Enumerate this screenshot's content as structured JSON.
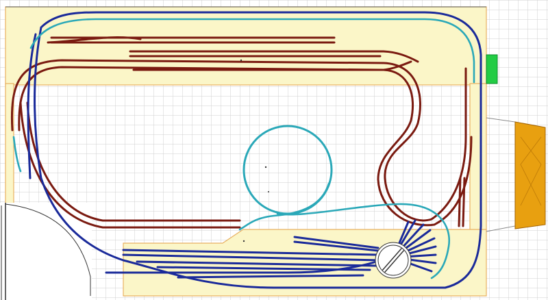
{
  "canvas": {
    "background": "#ffffff",
    "grid_color": "#cfcfcf"
  },
  "colors": {
    "baseboard_fill": "#fbf6c8",
    "baseboard_edge": "#e8b060",
    "upper_level_track": "#7a1a10",
    "upper_level_rail_gap": "#b86a5a",
    "main_loop_track": "#1a2a9a",
    "helix_track": "#2aa8b8",
    "turntable_outline": "#333333",
    "building": "#e8a010",
    "building_outline": "#a06000",
    "power_box": "#22cc44",
    "wall_line": "#333333"
  },
  "icons": {
    "turntable": "turntable-icon",
    "building": "engine-shed-icon",
    "power_box": "control-panel-icon",
    "door": "door-arc-icon"
  },
  "layout_plan": {
    "tracks": [
      "upper-level",
      "main-loop",
      "helix",
      "yard"
    ],
    "stub_sidings_at_turntable": 9
  }
}
